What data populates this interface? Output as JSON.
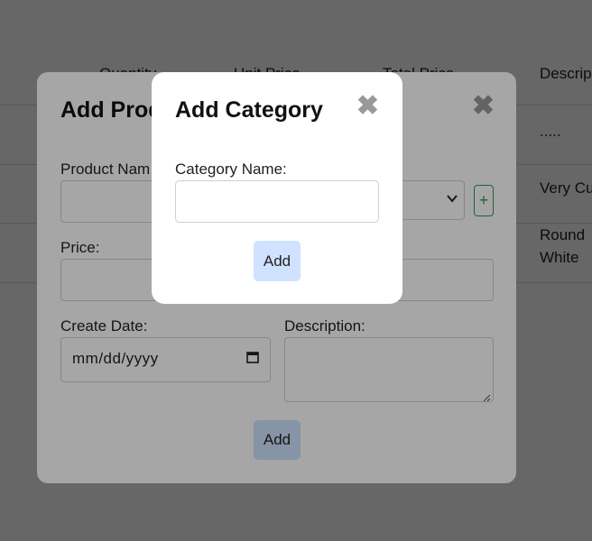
{
  "table": {
    "headers": [
      "Quantity",
      "Unit Price",
      "Total Price",
      "Descrip"
    ],
    "rows": [
      {
        "description": "....."
      },
      {
        "description": "Very Cu"
      },
      {
        "description_line1": "Round",
        "description_line2": "White"
      }
    ]
  },
  "product_modal": {
    "title": "Add Prod",
    "close": "✖",
    "product_name_label": "Product Nam",
    "price_label": "Price:",
    "create_date_label": "Create Date:",
    "date_placeholder": "mm/dd/yyyy",
    "description_label": "Description:",
    "add_category_symbol": "+",
    "add_button": "Add"
  },
  "category_modal": {
    "title": "Add Category",
    "close": "✖",
    "category_name_label": "Category Name:",
    "category_name_value": "",
    "add_button": "Add"
  }
}
